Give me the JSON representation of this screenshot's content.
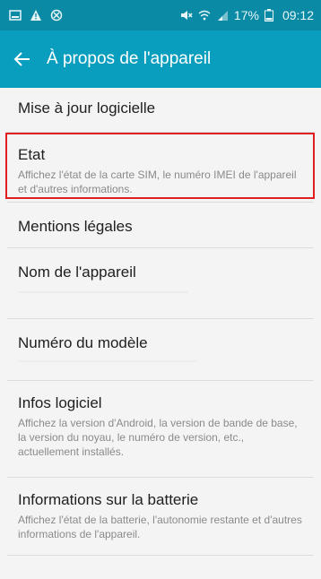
{
  "status_bar": {
    "icons_left": [
      "gallery-icon",
      "warning-icon",
      "blocked-icon"
    ],
    "battery": "17%",
    "time": "09:12"
  },
  "header": {
    "title": "À propos de l'appareil"
  },
  "items": [
    {
      "title": "Mise à jour logicielle"
    },
    {
      "title": "Etat",
      "desc": "Affichez l'état de la carte SIM, le numéro IMEI de l'appareil et d'autres informations."
    },
    {
      "title": "Mentions légales"
    },
    {
      "title": "Nom de l'appareil"
    },
    {
      "title": "Numéro du modèle"
    },
    {
      "title": "Infos logiciel",
      "desc": "Affichez la version d'Android, la version de bande de base, la version du noyau, le numéro de version, etc., actuellement installés."
    },
    {
      "title": "Informations sur la batterie",
      "desc": "Affichez l'état de la batterie, l'autonomie restante et d'autres informations de l'appareil."
    }
  ],
  "colors": {
    "status_bar": "#0a8aa5",
    "app_bar": "#0a9ebe",
    "highlight": "#e21f1f"
  }
}
